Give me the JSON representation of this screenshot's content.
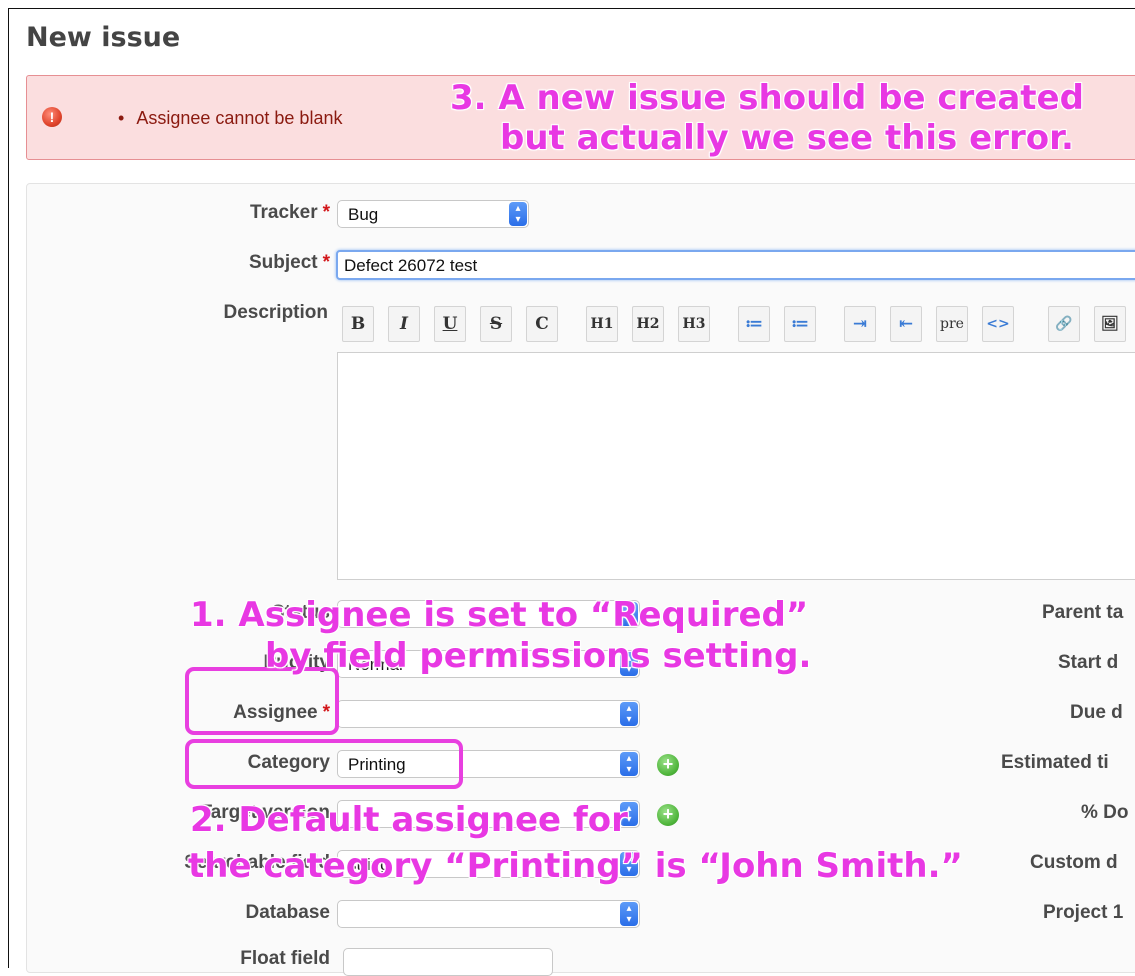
{
  "page": {
    "title": "New issue"
  },
  "errors": {
    "items": [
      "Assignee cannot be blank"
    ]
  },
  "form": {
    "tracker": {
      "label": "Tracker",
      "value": "Bug"
    },
    "subject": {
      "label": "Subject",
      "value": "Defect 26072 test"
    },
    "description": {
      "label": "Description"
    },
    "toolbar": [
      "B",
      "I",
      "U",
      "S",
      "C",
      "H1",
      "H2",
      "H3",
      "≔",
      "≔",
      "⇥",
      "⇤",
      "pre",
      "<>",
      "🔗",
      "🖼"
    ],
    "status": {
      "label": "Status"
    },
    "priority": {
      "label": "Priority",
      "value": "Normal"
    },
    "assignee": {
      "label": "Assignee",
      "value": ""
    },
    "category": {
      "label": "Category",
      "value": "Printing"
    },
    "target_version": {
      "label": "Target version"
    },
    "searchable_field": {
      "label": "Searchable field",
      "value": "string"
    },
    "database": {
      "label": "Database",
      "value": ""
    },
    "float_field": {
      "label": "Float field"
    },
    "required_mark": "*"
  },
  "right_labels": [
    "Parent ta",
    "Start d",
    "Due d",
    "Estimated ti",
    "% Do",
    "Custom d",
    "Project 1"
  ],
  "annotations": {
    "a3_line1": "3. A new issue should be created",
    "a3_line2": "but actually we see this error.",
    "a1_line1": "1. Assignee is set to “Required”",
    "a1_line2": "by field permissions setting.",
    "a2_line1": "2. Default assignee for",
    "a2_line2": "the category “Printing” is “John Smith.”"
  },
  "colors": {
    "annotation": "#e838e3",
    "error_bg": "#fbdedf",
    "required": "#d2161a"
  }
}
